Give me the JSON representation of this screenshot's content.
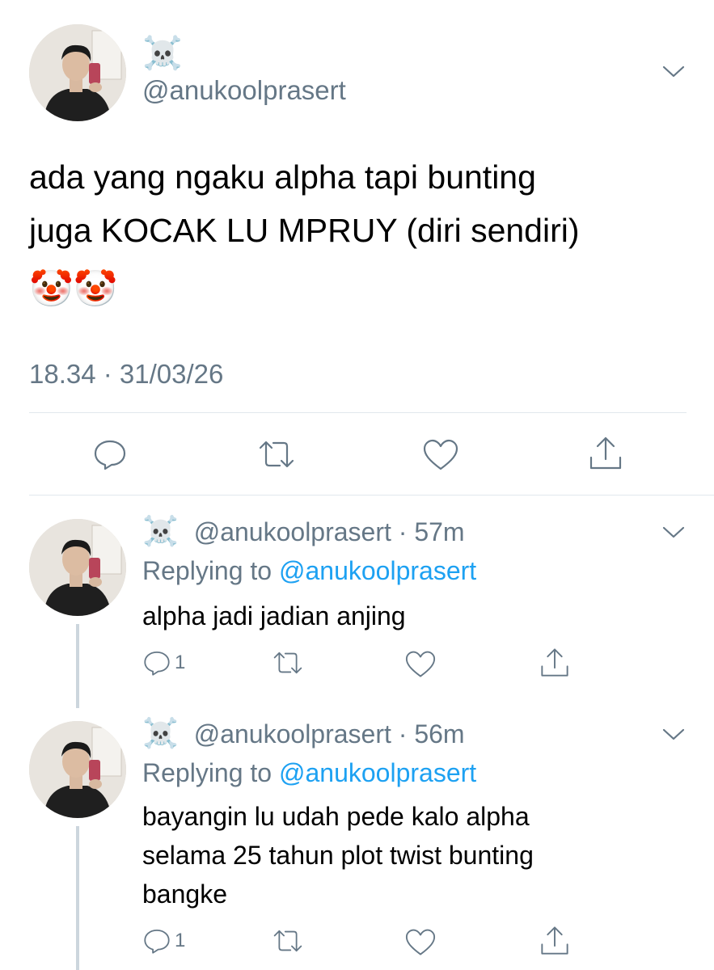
{
  "main_tweet": {
    "name_emoji": "☠️",
    "handle": "@anukoolprasert",
    "text_line1": "ada yang ngaku alpha tapi bunting",
    "text_line2": "juga KOCAK LU MPRUY (diri sendiri)",
    "emojis": "🤡🤡",
    "timestamp": "18.34 · 31/03/26"
  },
  "replies": [
    {
      "name_emoji": "☠️",
      "handle": "@anukoolprasert",
      "time": "· 57m",
      "replying_prefix": "Replying to",
      "replying_to": "@anukoolprasert",
      "text_lines": [
        "alpha jadi jadian anjing"
      ],
      "reply_count": "1"
    },
    {
      "name_emoji": "☠️",
      "handle": "@anukoolprasert",
      "time": "· 56m",
      "replying_prefix": "Replying to",
      "replying_to": "@anukoolprasert",
      "text_lines": [
        "bayangin lu udah pede kalo alpha",
        "selama 25 tahun plot twist bunting",
        "bangke"
      ],
      "reply_count": "1"
    }
  ],
  "icons": {
    "more": "chevron-down-icon",
    "reply": "speech-bubble-icon",
    "retweet": "retweet-icon",
    "like": "heart-icon",
    "share": "share-upload-icon"
  },
  "colors": {
    "text": "#000000",
    "secondary": "#657786",
    "link": "#1da1f2",
    "divider": "#e1e8ed",
    "thread_line": "#ccd6dd"
  }
}
